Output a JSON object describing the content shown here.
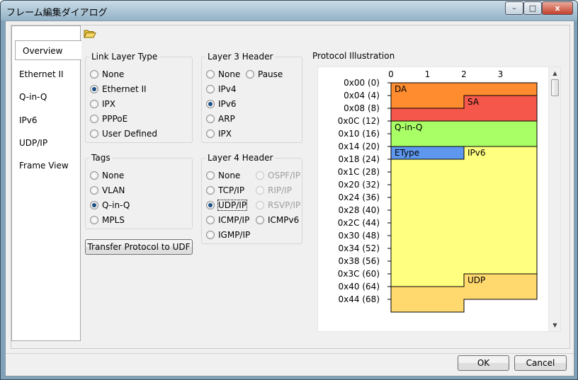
{
  "window": {
    "title": "フレーム編集ダイアログ",
    "controls": {
      "minimize": "–",
      "maximize": "□",
      "close": "x"
    }
  },
  "sidebar": {
    "tabs": [
      "Overview",
      "Ethernet II",
      "Q-in-Q",
      "IPv6",
      "UDP/IP",
      "Frame View"
    ],
    "active": "Overview"
  },
  "toolbar": {
    "open_icon": "folder-open-icon"
  },
  "link_layer": {
    "label": "Link Layer Type",
    "options": [
      {
        "label": "None",
        "checked": false
      },
      {
        "label": "Ethernet II",
        "checked": true
      },
      {
        "label": "IPX",
        "checked": false
      },
      {
        "label": "PPPoE",
        "checked": false
      },
      {
        "label": "User Defined",
        "checked": false
      }
    ]
  },
  "tags": {
    "label": "Tags",
    "options": [
      {
        "label": "None",
        "checked": false
      },
      {
        "label": "VLAN",
        "checked": false
      },
      {
        "label": "Q-in-Q",
        "checked": true
      },
      {
        "label": "MPLS",
        "checked": false
      }
    ]
  },
  "layer3": {
    "label": "Layer 3 Header",
    "options": [
      {
        "label": "None",
        "checked": false
      },
      {
        "label": "Pause",
        "checked": false
      },
      {
        "label": "IPv4",
        "checked": false
      },
      {
        "label": "IPv6",
        "checked": true
      },
      {
        "label": "ARP",
        "checked": false
      },
      {
        "label": "IPX",
        "checked": false
      }
    ]
  },
  "layer4": {
    "label": "Layer 4 Header",
    "options": [
      {
        "label": "None",
        "checked": false,
        "disabled": false
      },
      {
        "label": "OSPF/IP",
        "checked": false,
        "disabled": true
      },
      {
        "label": "TCP/IP",
        "checked": false,
        "disabled": false
      },
      {
        "label": "RIP/IP",
        "checked": false,
        "disabled": true
      },
      {
        "label": "UDP/IP",
        "checked": true,
        "disabled": false
      },
      {
        "label": "RSVP/IP",
        "checked": false,
        "disabled": true
      },
      {
        "label": "ICMP/IP",
        "checked": false,
        "disabled": false
      },
      {
        "label": "ICMPv6",
        "checked": false,
        "disabled": false
      },
      {
        "label": "IGMP/IP",
        "checked": false,
        "disabled": false
      }
    ]
  },
  "transfer_button": "Transfer Protocol to UDF",
  "illustration": {
    "label": "Protocol Illustration",
    "columns": [
      "0",
      "1",
      "2",
      "3"
    ],
    "rows": [
      "0x00 (0)",
      "0x04 (4)",
      "0x08 (8)",
      "0x0C (12)",
      "0x10 (16)",
      "0x14 (20)",
      "0x18 (24)",
      "0x1C (28)",
      "0x20 (32)",
      "0x24 (36)",
      "0x28 (40)",
      "0x2C (44)",
      "0x30 (48)",
      "0x34 (52)",
      "0x38 (56)",
      "0x3C (60)",
      "0x40 (64)",
      "0x44 (68)"
    ],
    "fields": [
      {
        "label": "DA",
        "start": 0,
        "length": 6,
        "color": "#ff8c2e"
      },
      {
        "label": "SA",
        "start": 6,
        "length": 6,
        "color": "#f5584a"
      },
      {
        "label": "Q-in-Q",
        "start": 12,
        "length": 8,
        "color": "#a8ff66"
      },
      {
        "label": "EType",
        "start": 20,
        "length": 2,
        "color": "#5e97ee"
      },
      {
        "label": "IPv6",
        "start": 22,
        "length": 40,
        "color": "#ffff80"
      },
      {
        "label": "UDP",
        "start": 62,
        "length": 8,
        "color": "#ffd86e"
      }
    ],
    "scroll": {
      "up": "▲",
      "down": "▼"
    }
  },
  "buttons": {
    "ok": "OK",
    "cancel": "Cancel"
  }
}
